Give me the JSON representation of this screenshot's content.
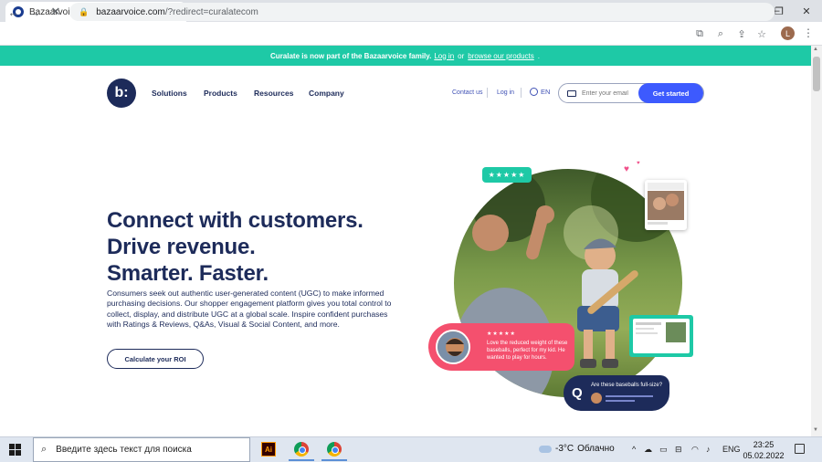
{
  "browser": {
    "tab_title": "Bazaarvoice: Meet shoppers in all",
    "tab_close": "×",
    "new_tab": "+",
    "url_domain": "bazaarvoice.com",
    "url_rest": "/?redirect=curalatecom",
    "lock": "🔒",
    "back": "←",
    "forward": "→",
    "stop": "✕",
    "minimize": "—",
    "maximize": "❐",
    "close": "✕",
    "tab_search": "⌄",
    "translate_icon": "⧉",
    "zoom_icon": "⌕",
    "share_icon": "⇪",
    "bookmark_icon": "☆",
    "ext_icon": "▭",
    "profile_initial": "L",
    "menu": "⋮"
  },
  "banner": {
    "text": "Curalate is now part of the Bazaarvoice family.",
    "login": "Log in",
    "or": "or",
    "browse": "browse our products",
    "period": "."
  },
  "nav": {
    "logo": "b:",
    "items": [
      "Solutions",
      "Products",
      "Resources",
      "Company"
    ],
    "contact": "Contact us",
    "login": "Log in",
    "lang": "EN",
    "email_placeholder": "Enter your email",
    "cta": "Get started"
  },
  "hero": {
    "line1": "Connect with customers.",
    "line2": "Drive revenue.",
    "line3": "Smarter. Faster.",
    "body": "Consumers seek out authentic user-generated content (UGC) to make informed purchasing decisions. Our shopper engagement platform gives you total control to collect, display, and distribute UGC at a global scale. Inspire confident purchases with Ratings & Reviews, Q&As, Visual & Social Content, and more.",
    "roi_button": "Calculate your ROI"
  },
  "visual": {
    "badge_stars": "★★★★★",
    "review_stars": "★★★★★",
    "review_text": "Love the reduced weight of these baseballs, perfect for my kid. He wanted to play for hours.",
    "qa_q": "Q",
    "qa_text": "Are these baseballs full-size?",
    "heart": "♥"
  },
  "taskbar": {
    "search_placeholder": "Введите здесь текст для поиска",
    "ai_label": "Ai",
    "temperature": "-3°C",
    "weather": "Облачно",
    "lang": "ENG",
    "time": "23:25",
    "date": "05.02.2022",
    "tray_icons": [
      "^",
      "☁",
      "▭",
      "⊟",
      "◠",
      "♪"
    ]
  },
  "colors": {
    "brand_navy": "#1d2b5a",
    "accent_teal": "#1ec9a6",
    "cta_blue": "#3d5afe",
    "review_pink": "#f4506e"
  }
}
